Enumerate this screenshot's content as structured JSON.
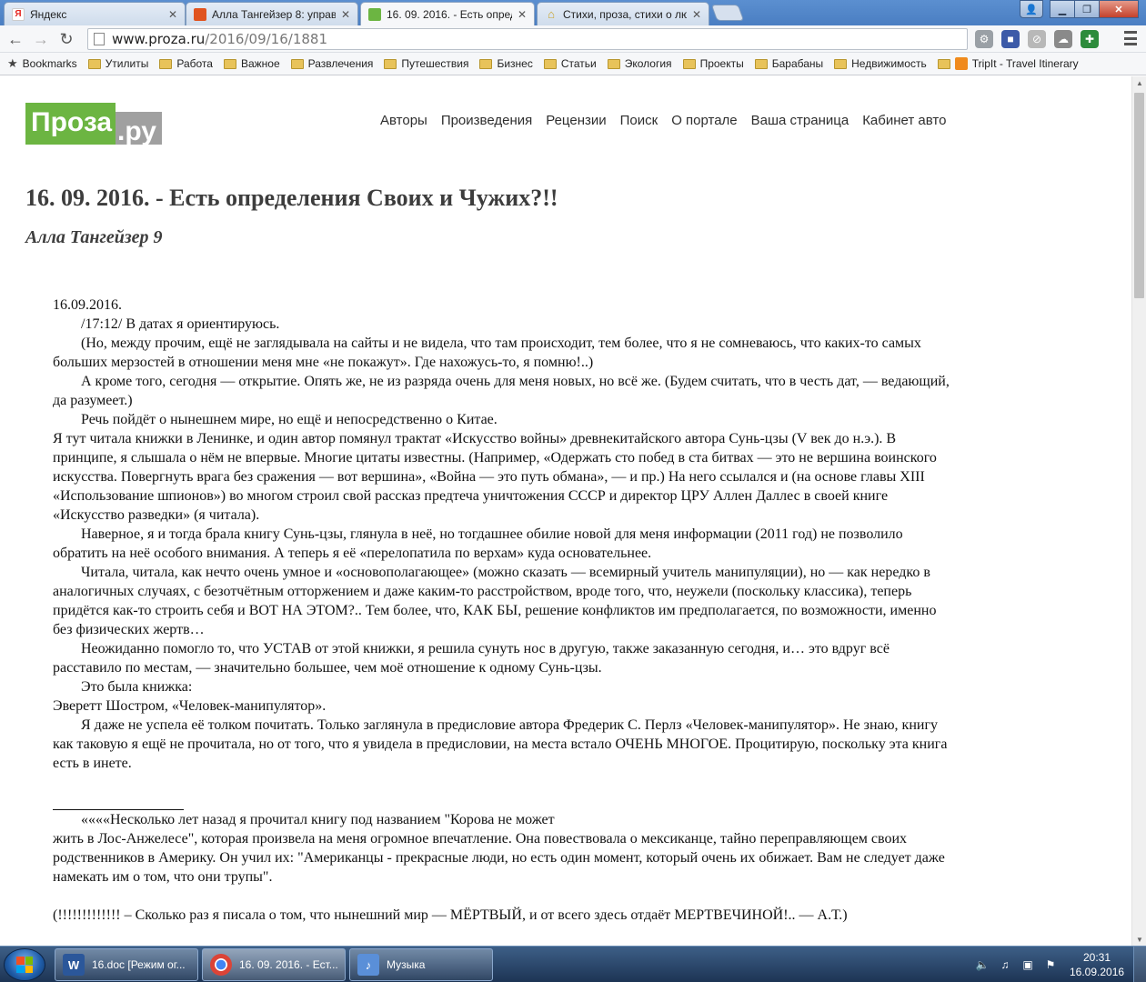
{
  "browser": {
    "tabs": [
      {
        "title": "Яндекс",
        "icon": "yandex-icon",
        "color": "#e5e5e5"
      },
      {
        "title": "Алла Тангейзер 8: управ",
        "icon": "proza-author-icon",
        "color": "#e0531f"
      },
      {
        "title": "16. 09. 2016. - Есть опред",
        "icon": "proza-icon",
        "color": "#6cb542"
      },
      {
        "title": "Стихи, проза, стихи о лю",
        "icon": "home-icon",
        "color": "#c9a227"
      }
    ],
    "url_host": "www.proza.ru",
    "url_path": "/2016/09/16/1881",
    "bookmarks": [
      "Bookmarks",
      "Утилиты",
      "Работа",
      "Важное",
      "Развлечения",
      "Путешествия",
      "Бизнес",
      "Статьи",
      "Экология",
      "Проекты",
      "Барабаны",
      "Недвижимость",
      "TripIt - Travel Itinerary"
    ]
  },
  "site": {
    "logo_part1": "Проза",
    "logo_part2": ".ру",
    "nav": [
      "Авторы",
      "Произведения",
      "Рецензии",
      "Поиск",
      "О портале",
      "Ваша страница",
      "Кабинет авто"
    ]
  },
  "article": {
    "title": "16. 09. 2016. - Есть определения Своих и Чужих?!!",
    "author": "Алла Тангейзер 9",
    "paragraphs": [
      "16.09.2016.",
      "/17:12/ В датах я ориентируюсь.",
      "(Но, между прочим, ещё не заглядывала на сайты и не видела, что там происходит, тем более, что я не сомневаюсь, что каких-то самых больших мерзостей в отношении меня мне «не покажут». Где нахожусь-то, я помню!..)",
      "А кроме того, сегодня — открытие. Опять же, не из разряда очень для меня новых, но всё же. (Будем считать, что в честь дат, — ведающий, да разумеет.)",
      "Речь пойдёт о нынешнем мире, но ещё и непосредственно о Китае.",
      "Я тут читала книжки в Ленинке, и один автор помянул трактат «Искусство войны» древнекитайского автора Сунь-цзы (V век до н.э.). В принципе, я слышала о нём не впервые. Многие цитаты известны. (Например, «Одержать сто побед в ста битвах — это не вершина воинского искусства. Повергнуть врага без сражения — вот вершина», «Война — это путь обмана», — и пр.) На него ссылался и (на основе главы XIII «Использование шпионов») во многом строил свой рассказ предтеча уничтожения СССР и директор ЦРУ Аллен Даллес в своей книге «Искусство разведки» (я читала).",
      "Наверное, я и тогда брала книгу Сунь-цзы, глянула в неё, но тогдашнее обилие новой для меня информации (2011 год) не позволило обратить на неё особого внимания. А теперь я её «перелопатила по верхам» куда основательнее.",
      "Читала, читала, как нечто очень умное и «основополагающее» (можно сказать — всемирный учитель манипуляции), но — как нередко в аналогичных случаях, с безотчётным отторжением и даже каким-то расстройством, вроде того, что, неужели (поскольку классика), теперь придётся как-то строить себя и ВОТ НА ЭТОМ?.. Тем более, что, КАК БЫ, решение конфликтов им предполагается, по возможности, именно без физических жертв…",
      "Неожиданно помогло то, что УСТАВ от этой книжки, я решила сунуть нос в другую, также заказанную сегодня, и… это вдруг всё расставило по местам, — значительно большее, чем моё отношение к одному Сунь-цзы.",
      "Это была книжка:",
      "Эверетт Шостром, «Человек-манипулятор».",
      "Я даже не успела её толком почитать. Только заглянула в предисловие автора Фредерик С. Перлз «Человек-манипулятор». Не знаю, книгу как таковую я ещё не прочитала, но от того, что я увидела в предисловии, на места встало ОЧЕНЬ МНОГОЕ. Процитирую, поскольку эта книга есть в инете."
    ],
    "quote_first_line": "««««Несколько лет назад я прочитал книгу под названием \"Корова не может",
    "quote_rest": "жить в Лос-Анжелесе\", которая произвела на меня огромное впечатление. Она повествовала о мексиканце, тайно переправляющем своих родственников в Америку. Он учил их: \"Американцы - прекрасные люди, но есть один момент, который очень их обижает. Вам не следует даже намекать им о том, что они трупы\".",
    "comment": "(!!!!!!!!!!!!! – Сколько раз я писала о том, что нынешний мир — МЁРТВЫЙ, и от всего здесь отдаёт МЕРТВЕЧИНОЙ!.. — А.Т.)"
  },
  "taskbar": {
    "items": [
      {
        "label": "16.doc [Режим ог...",
        "icon": "word-icon"
      },
      {
        "label": "16. 09. 2016. - Ест...",
        "icon": "chrome-icon"
      },
      {
        "label": "Музыка",
        "icon": "media-icon"
      }
    ],
    "time": "20:31",
    "date": "16.09.2016"
  },
  "colors": {
    "logo_green": "#6cb542",
    "logo_gray": "#a0a0a0",
    "title_text": "#3d3d3d"
  }
}
